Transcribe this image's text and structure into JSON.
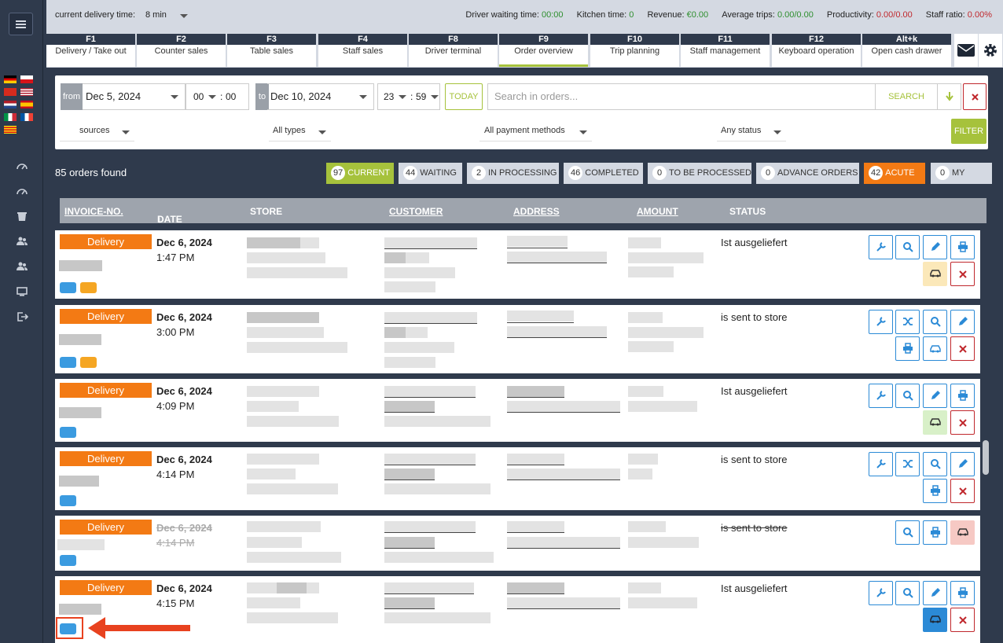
{
  "topbar": {
    "delivery_time_label": "current delivery time:",
    "delivery_time_value": "8 min",
    "metrics": [
      {
        "label": "Driver waiting time:",
        "value": "00:00",
        "color": "#2e8f2e"
      },
      {
        "label": "Kitchen time:",
        "value": "0",
        "color": "#2e8f2e"
      },
      {
        "label": "Revenue:",
        "value": "€0.00",
        "color": "#2e8f2e"
      },
      {
        "label": "Average trips:",
        "value": "0.00/0.00",
        "color": "#2e8f2e"
      },
      {
        "label": "Productivity:",
        "value": "0.00/0.00",
        "color": "#c0282d"
      },
      {
        "label": "Staff ratio:",
        "value": "0.00%",
        "color": "#c0282d"
      }
    ]
  },
  "tabs": [
    {
      "key": "F1",
      "label": "Delivery / Take out"
    },
    {
      "key": "F2",
      "label": "Counter sales"
    },
    {
      "key": "F3",
      "label": "Table sales"
    },
    {
      "key": "F4",
      "label": "Staff sales"
    },
    {
      "key": "F8",
      "label": "Driver terminal"
    },
    {
      "key": "F9",
      "label": "Order overview",
      "active": true
    },
    {
      "key": "F10",
      "label": "Trip planning"
    },
    {
      "key": "F11",
      "label": "Staff management"
    },
    {
      "key": "F12",
      "label": "Keyboard operation"
    },
    {
      "key": "Alt+k",
      "label": "Open cash drawer"
    }
  ],
  "filter": {
    "from_label": "from",
    "from_date": "Dec 5, 2024",
    "from_hour": "00",
    "from_min": "00",
    "to_label": "to",
    "to_date": "Dec 10, 2024",
    "to_hour": "23",
    "to_min": "59",
    "today_label": "TODAY",
    "search_placeholder": "Search in orders...",
    "search_label": "SEARCH",
    "sources": "sources",
    "types": "All types",
    "payment": "All payment methods",
    "status": "Any status",
    "filter_label": "FILTER"
  },
  "orders_found": "85 orders found",
  "status_pills": [
    {
      "count": "97",
      "label": "CURRENT"
    },
    {
      "count": "44",
      "label": "WAITING"
    },
    {
      "count": "2",
      "label": "IN PROCESSING"
    },
    {
      "count": "46",
      "label": "COMPLETED"
    },
    {
      "count": "0",
      "label": "TO BE PROCESSED"
    },
    {
      "count": "0",
      "label": "ADVANCE ORDERS"
    },
    {
      "count": "42",
      "label": "ACUTE"
    },
    {
      "count": "0",
      "label": "MY"
    }
  ],
  "columns": {
    "invoice": "INVOICE-NO.",
    "date": "DATE",
    "date_sort_icon": "↓",
    "store": "STORE",
    "customer": "CUSTOMER",
    "address": "ADDRESS",
    "amount": "AMOUNT",
    "status": "STATUS"
  },
  "rows": [
    {
      "type": "Delivery",
      "date": "Dec 6, 2024",
      "time": "1:47 PM",
      "status": "Ist ausgeliefert"
    },
    {
      "type": "Delivery",
      "date": "Dec 6, 2024",
      "time": "3:00 PM",
      "status": "is sent to store"
    },
    {
      "type": "Delivery",
      "date": "Dec 6, 2024",
      "time": "4:09 PM",
      "status": "Ist ausgeliefert"
    },
    {
      "type": "Delivery",
      "date": "Dec 6, 2024",
      "time": "4:14 PM",
      "status": "is sent to store"
    },
    {
      "type": "Delivery",
      "date": "Dec 6, 2024",
      "time": "4:14 PM",
      "status": "is sent to store",
      "cancelled": true
    },
    {
      "type": "Delivery",
      "date": "Dec 6, 2024",
      "time": "4:15 PM",
      "status": "Ist ausgeliefert"
    }
  ],
  "colors": {
    "accent": "#a6c23c",
    "orange": "#f37a14",
    "blue": "#2b8ad6",
    "red": "#c0282d",
    "nav": "#2f3a4c"
  }
}
